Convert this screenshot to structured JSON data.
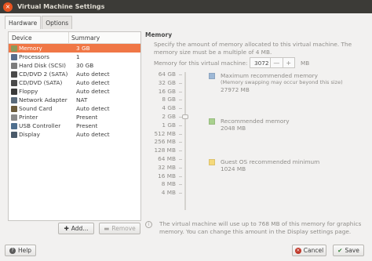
{
  "window": {
    "title": "Virtual Machine Settings",
    "close_glyph": "×"
  },
  "tabs": [
    {
      "label": "Hardware",
      "active": true
    },
    {
      "label": "Options",
      "active": false
    }
  ],
  "device_list": {
    "columns": [
      "Device",
      "Summary"
    ],
    "rows": [
      {
        "device": "Memory",
        "summary": "3 GB",
        "icon": "memory-icon",
        "color": "#8a9a5b",
        "selected": true
      },
      {
        "device": "Processors",
        "summary": "1",
        "icon": "processor-icon",
        "color": "#5a6e8c"
      },
      {
        "device": "Hard Disk (SCSI)",
        "summary": "30 GB",
        "icon": "hard-disk-icon",
        "color": "#7d7d7d"
      },
      {
        "device": "CD/DVD 2 (SATA)",
        "summary": "Auto detect",
        "icon": "cd-dvd-icon",
        "color": "#4a4a4a"
      },
      {
        "device": "CD/DVD (SATA)",
        "summary": "Auto detect",
        "icon": "cd-dvd-icon",
        "color": "#4a4a4a"
      },
      {
        "device": "Floppy",
        "summary": "Auto detect",
        "icon": "floppy-icon",
        "color": "#3a3a3a"
      },
      {
        "device": "Network Adapter",
        "summary": "NAT",
        "icon": "network-adapter-icon",
        "color": "#5b6b7b"
      },
      {
        "device": "Sound Card",
        "summary": "Auto detect",
        "icon": "sound-card-icon",
        "color": "#6b5b3b"
      },
      {
        "device": "Printer",
        "summary": "Present",
        "icon": "printer-icon",
        "color": "#8a8a8a"
      },
      {
        "device": "USB Controller",
        "summary": "Present",
        "icon": "usb-controller-icon",
        "color": "#4f6f8f"
      },
      {
        "device": "Display",
        "summary": "Auto detect",
        "icon": "display-icon",
        "color": "#4a5a6a"
      }
    ]
  },
  "buttons": {
    "add": "Add...",
    "remove": "Remove",
    "help": "Help",
    "cancel": "Cancel",
    "save": "Save"
  },
  "memory": {
    "title": "Memory",
    "description": "Specify the amount of memory allocated to this virtual machine. The memory size must be a multiple of 4 MB.",
    "field_label": "Memory for this virtual machine:",
    "value": "3072",
    "minus_glyph": "—",
    "plus_glyph": "+",
    "unit": "MB",
    "scale": [
      "64 GB",
      "32 GB",
      "16 GB",
      "8 GB",
      "4 GB",
      "2 GB",
      "1 GB",
      "512 MB",
      "256 MB",
      "128 MB",
      "64 MB",
      "32 MB",
      "16 MB",
      "8 MB",
      "4 MB"
    ],
    "legend": [
      {
        "title": "Maximum recommended memory",
        "note": "(Memory swapping may occur beyond this size)",
        "value": "27972 MB",
        "color": "#9db8d6"
      },
      {
        "title": "Recommended memory",
        "value": "2048 MB",
        "color": "#a9d18e"
      },
      {
        "title": "Guest OS recommended minimum",
        "value": "1024 MB",
        "color": "#f5d97a"
      }
    ],
    "info": "The virtual machine will use up to 768 MB of this memory for graphics memory. You can change this amount in the Display settings page."
  },
  "colors": {
    "accent": "#f07746",
    "titlebar": "#3c3b37",
    "close": "#e95420"
  }
}
